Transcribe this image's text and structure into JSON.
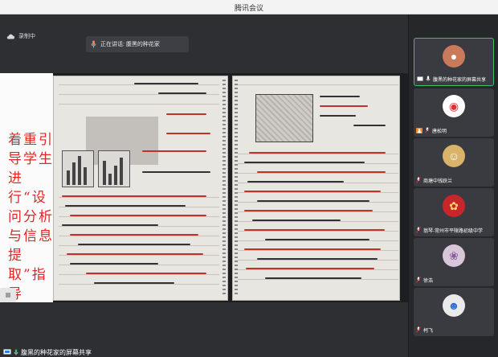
{
  "window": {
    "title": "腾讯会议"
  },
  "recording": {
    "label": "录制中",
    "icon": "cloud-record-icon"
  },
  "speaking": {
    "label": "正在讲话: 腹黑的种花家"
  },
  "share": {
    "caption": "着重引导学生进行“设问分析与信息提取”指导",
    "owner_label": "腹黑的种花家的屏幕共享"
  },
  "participants": [
    {
      "name": "腹黑的种花家的屏幕共享",
      "avatar": "profile-photo",
      "active": true
    },
    {
      "name": "唐松明",
      "avatar": "cartoon-avatar"
    },
    {
      "name": "商塘中钱跃兰",
      "avatar": "children-photo"
    },
    {
      "name": "翁琴-常州市平陵路初级中学",
      "avatar": "red-flower-photo"
    },
    {
      "name": "徐浩",
      "avatar": "purple-avatar"
    },
    {
      "name": "柯飞",
      "avatar": "cartoon-boy-avatar"
    }
  ],
  "colors": {
    "accent": "#3bc06b",
    "caption_red": "#e32526",
    "bg": "#2e2f33"
  }
}
